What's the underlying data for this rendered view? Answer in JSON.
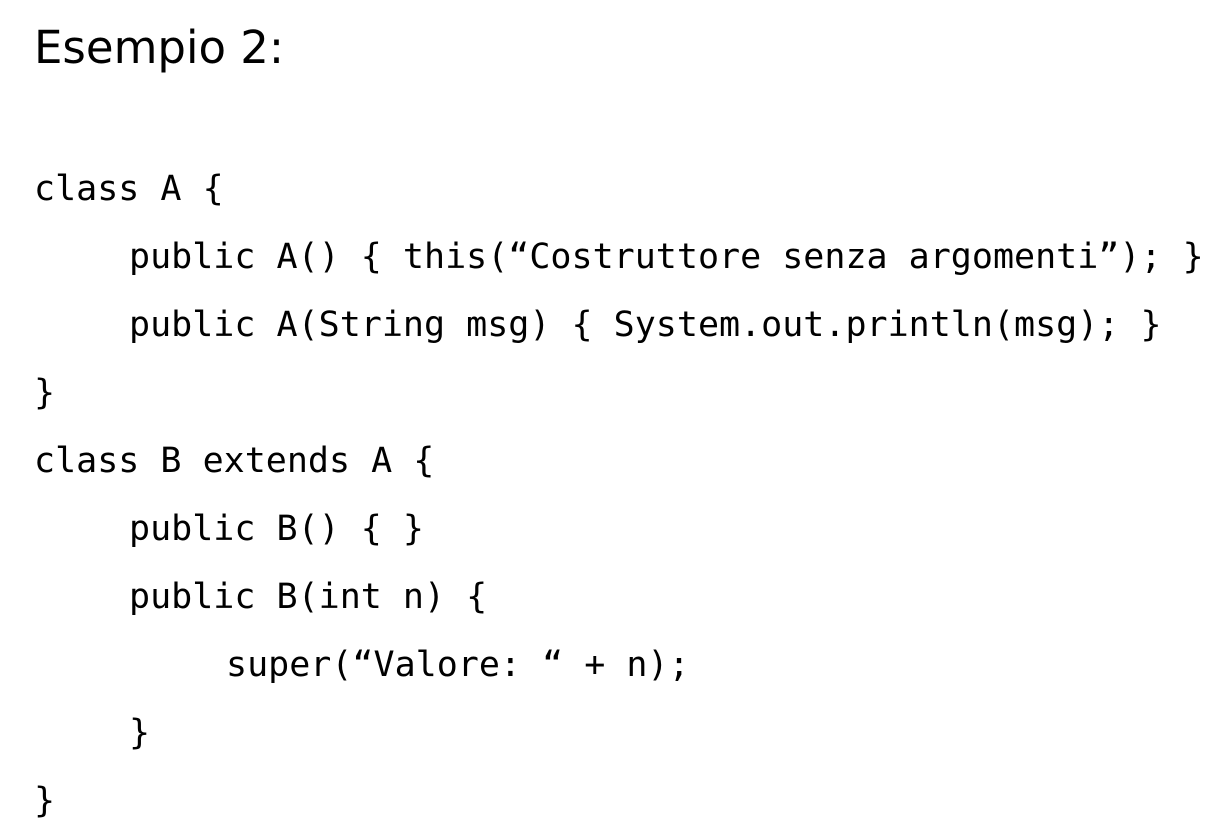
{
  "title": "Esempio 2:",
  "code": {
    "lines": [
      "class A {",
      "public A() { this(“Costruttore senza argomenti”); }",
      "public A(String msg) { System.out.println(msg); }",
      "}",
      "class B extends A {",
      "public B() { }",
      "public B(int n) {",
      "super(“Valore: “ + n);",
      "}",
      "}"
    ]
  }
}
